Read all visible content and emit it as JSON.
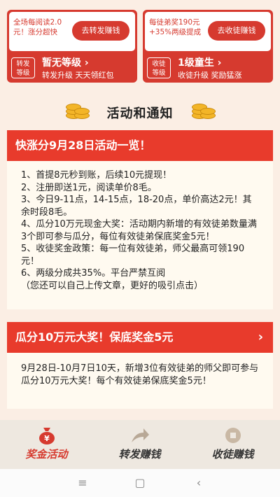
{
  "cards": {
    "left": {
      "promo_text": "全场每阅读2.0元！涨分超快",
      "button": "去转发赚钱",
      "badge": "转发\n等级",
      "level": "暂无等级 ›",
      "subtitle": "转发升级 天天领红包"
    },
    "right": {
      "promo_text": "每徒弟奖190元+35%两级提成",
      "button": "去收徒赚钱",
      "badge": "收徒\n等级",
      "level": "1级童生 ›",
      "subtitle": "收徒升级 奖励猛涨"
    }
  },
  "section_title": "活动和通知",
  "activity": {
    "title": "快涨分9月28日活动一览！",
    "lines": [
      "1、首提8元秒到账，后续10元提现！",
      "2、注册即送1元，阅读单价8毛。",
      "3、今日9-11点，14-15点，18-20点，单价高达2元！其余时段8毛。",
      "4、瓜分10万元现金大奖：活动期内新增的有效徒弟数量满3个即可参与瓜分，每位有效徒弟保底奖金5元！",
      "5、收徒奖金政策：每一位有效徒弟，师父最高可领190元！",
      "6、两级分成共35%。平台严禁互阅",
      "（您还可以自己上传文章，更好的吸引点击）"
    ]
  },
  "prize": {
    "title": "瓜分10万元大奖！保底奖金5元",
    "body": "9月28日-10月7日10天，新增3位有效徒弟的师父即可参与瓜分10万元大奖！每个有效徒弟保底奖金5元！"
  },
  "tabs": [
    {
      "label": "奖金活动",
      "icon": "money-bag-icon",
      "active": true
    },
    {
      "label": "转发赚钱",
      "icon": "share-arrow-icon",
      "active": false
    },
    {
      "label": "收徒赚钱",
      "icon": "coin-icon",
      "active": false
    }
  ],
  "colors": {
    "brand_red": "#d63a2f",
    "header_red": "#e83b2c",
    "background": "#fbeee4"
  },
  "system_nav": {
    "menu": "≡",
    "home": "▢",
    "back": "‹"
  }
}
